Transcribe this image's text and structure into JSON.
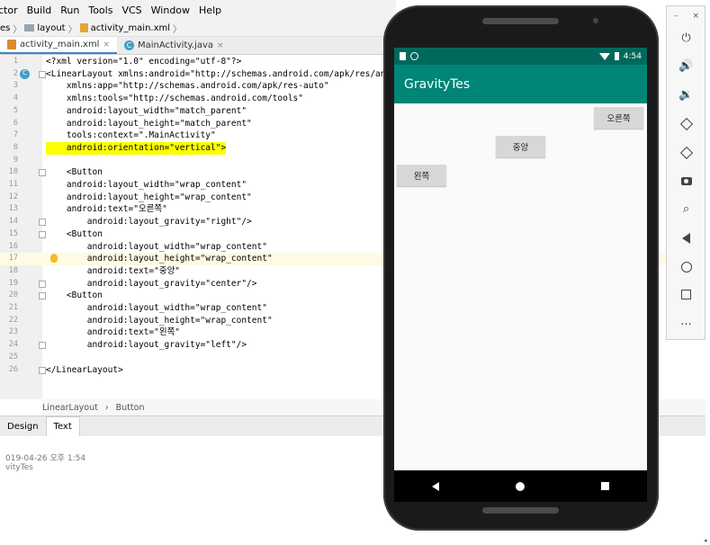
{
  "menubar": {
    "items": [
      "ctor",
      "Build",
      "Run",
      "Tools",
      "VCS",
      "Window",
      "Help"
    ]
  },
  "breadcrumb": {
    "items": [
      "es",
      "layout",
      "activity_main.xml"
    ]
  },
  "editor_tabs": [
    {
      "label": "activity_main.xml",
      "close": "×"
    },
    {
      "label": "MainActivity.java",
      "close": "×"
    }
  ],
  "code_lines": [
    {
      "num": "1",
      "text": "<?xml version=\"1.0\" encoding=\"utf-8\"?>"
    },
    {
      "num": "2",
      "text": "<LinearLayout xmlns:android=\"http://schemas.android.com/apk/res/android\""
    },
    {
      "num": "3",
      "text": "    xmlns:app=\"http://schemas.android.com/apk/res-auto\""
    },
    {
      "num": "4",
      "text": "    xmlns:tools=\"http://schemas.android.com/tools\""
    },
    {
      "num": "5",
      "text": "    android:layout_width=\"match_parent\""
    },
    {
      "num": "6",
      "text": "    android:layout_height=\"match_parent\""
    },
    {
      "num": "7",
      "text": "    tools:context=\".MainActivity\""
    },
    {
      "num": "8",
      "text": "    android:orientation=\"vertical\">"
    },
    {
      "num": "9",
      "text": ""
    },
    {
      "num": "10",
      "text": "    <Button"
    },
    {
      "num": "11",
      "text": "    android:layout_width=\"wrap_content\""
    },
    {
      "num": "12",
      "text": "    android:layout_height=\"wrap_content\""
    },
    {
      "num": "13",
      "text": "    android:text=\"오른쪽\""
    },
    {
      "num": "14",
      "text": "        android:layout_gravity=\"right\"/>"
    },
    {
      "num": "15",
      "text": "    <Button"
    },
    {
      "num": "16",
      "text": "        android:layout_width=\"wrap_content\""
    },
    {
      "num": "17",
      "text": "        android:layout_height=\"wrap_content\""
    },
    {
      "num": "18",
      "text": "        android:text=\"중앙\""
    },
    {
      "num": "19",
      "text": "        android:layout_gravity=\"center\"/>"
    },
    {
      "num": "20",
      "text": "    <Button"
    },
    {
      "num": "21",
      "text": "        android:layout_width=\"wrap_content\""
    },
    {
      "num": "22",
      "text": "        android:layout_height=\"wrap_content\""
    },
    {
      "num": "23",
      "text": "        android:text=\"왼쪽\""
    },
    {
      "num": "24",
      "text": "        android:layout_gravity=\"left\"/>"
    },
    {
      "num": "25",
      "text": ""
    },
    {
      "num": "26",
      "text": "</LinearLayout>"
    }
  ],
  "status_path": {
    "items": [
      "LinearLayout",
      "Button"
    ],
    "separator": "›"
  },
  "bottom_tabs": [
    "Design",
    "Text"
  ],
  "log": {
    "line1": "019-04-26 오후 1:54",
    "line2": "vityTes"
  },
  "phone": {
    "status_time": "4:54",
    "app_title": "GravityTes",
    "buttons": {
      "right": "오른쪽",
      "center": "중앙",
      "left": "왼쪽"
    },
    "colors": {
      "statusbar": "#00695c",
      "appbar": "#008577"
    }
  },
  "emulator_toolbar": {
    "minimize": "–",
    "close": "×",
    "more": "..."
  }
}
